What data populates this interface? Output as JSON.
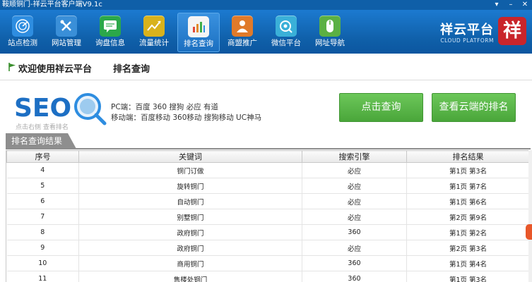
{
  "window": {
    "title": "鞍顺铜门-祥云平台客户端V9.1c",
    "controls": [
      "▾",
      "–",
      "✕"
    ]
  },
  "toolbar": {
    "items": [
      {
        "label": "站点检测",
        "icon": "radar-icon",
        "color": "#2e8de0",
        "active": false
      },
      {
        "label": "网站管理",
        "icon": "wrench-icon",
        "color": "#3a8fd8",
        "active": false
      },
      {
        "label": "询盘信息",
        "icon": "message-icon",
        "color": "#2ba84a",
        "active": false
      },
      {
        "label": "流量统计",
        "icon": "trend-icon",
        "color": "#d8b21c",
        "active": false
      },
      {
        "label": "排名查询",
        "icon": "bar-chart-icon",
        "color": "#e28a2a",
        "active": true
      },
      {
        "label": "商盟推广",
        "icon": "people-icon",
        "color": "#e07a2a",
        "active": false
      },
      {
        "label": "微信平台",
        "icon": "wechat-icon",
        "color": "#3ab0d8",
        "active": false
      },
      {
        "label": "网址导航",
        "icon": "mouse-icon",
        "color": "#5bb043",
        "active": false
      }
    ]
  },
  "brand": {
    "name": "祥云平台",
    "subtitle": "CLOUD PLATFORM",
    "seal": "祥"
  },
  "welcome": {
    "text": "欢迎使用祥云平台",
    "section": "排名查询"
  },
  "seo": {
    "logo_text": "SEO",
    "caption": "点击右侧 查看排名",
    "pc_line": "PC端：百度 360 搜狗 必应 有道",
    "mobile_line": "移动端：百度移动 360移动 搜狗移动 UC神马"
  },
  "buttons": {
    "query": "点击查询",
    "cloud": "查看云端的排名"
  },
  "results": {
    "tab": "排名查询结果",
    "columns": [
      "序号",
      "关键词",
      "搜索引擎",
      "排名结果"
    ],
    "rows": [
      [
        "4",
        "铜门订做",
        "必应",
        "第1页 第3名"
      ],
      [
        "5",
        "旋转铜门",
        "必应",
        "第1页 第7名"
      ],
      [
        "6",
        "自动铜门",
        "必应",
        "第1页 第6名"
      ],
      [
        "7",
        "别墅铜门",
        "必应",
        "第2页 第9名"
      ],
      [
        "8",
        "政府铜门",
        "360",
        "第1页 第2名"
      ],
      [
        "9",
        "政府铜门",
        "必应",
        "第2页 第3名"
      ],
      [
        "10",
        "商用铜门",
        "360",
        "第1页 第4名"
      ],
      [
        "11",
        "售楼处铜门",
        "360",
        "第1页 第3名"
      ]
    ]
  },
  "colors": {
    "toolbar": "#0f5fa8",
    "button_green": "#4aa63a",
    "brand_red": "#c9252b",
    "tab_gray": "#8e8e8e"
  }
}
